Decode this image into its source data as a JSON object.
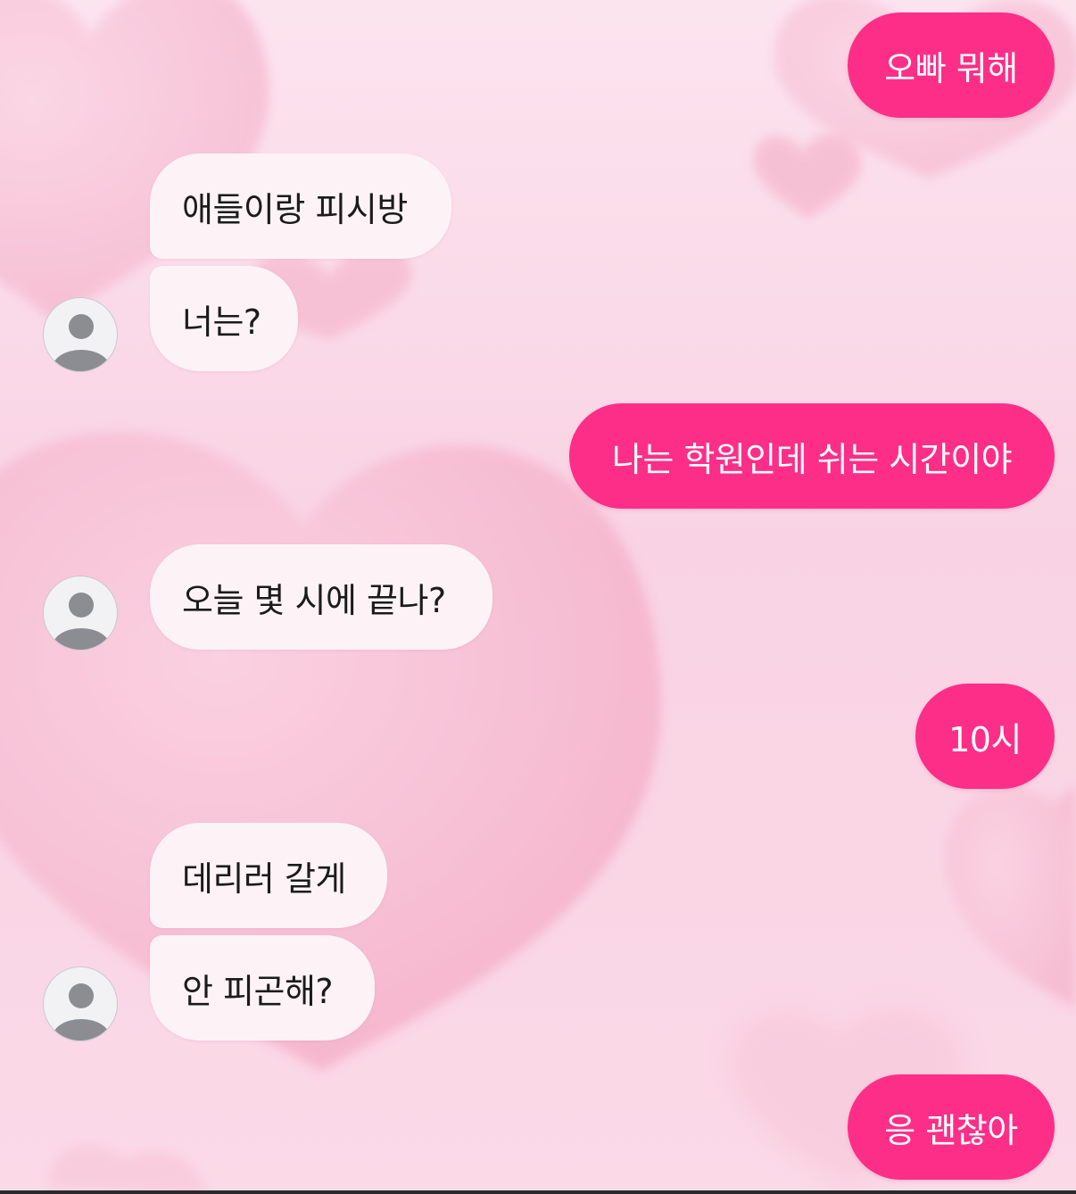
{
  "colors": {
    "outgoing_bubble": "#fd2e88",
    "incoming_bubble": "#fdf3f6",
    "background": "#fce4ef",
    "heart": "#f6b6cd",
    "avatar_fill": "#8b8d92"
  },
  "messages": [
    {
      "sender": "me",
      "text": "오빠 뭐해"
    },
    {
      "sender": "other",
      "text": "애들이랑 피시방"
    },
    {
      "sender": "other",
      "text": "너는?"
    },
    {
      "sender": "me",
      "text": "나는 학원인데 쉬는 시간이야"
    },
    {
      "sender": "other",
      "text": "오늘 몇 시에 끝나?"
    },
    {
      "sender": "me",
      "text": "10시"
    },
    {
      "sender": "other",
      "text": "데리러 갈게"
    },
    {
      "sender": "other",
      "text": "안 피곤해?"
    },
    {
      "sender": "me",
      "text": "응 괜찮아"
    }
  ],
  "avatar_icon": "default-user-icon"
}
